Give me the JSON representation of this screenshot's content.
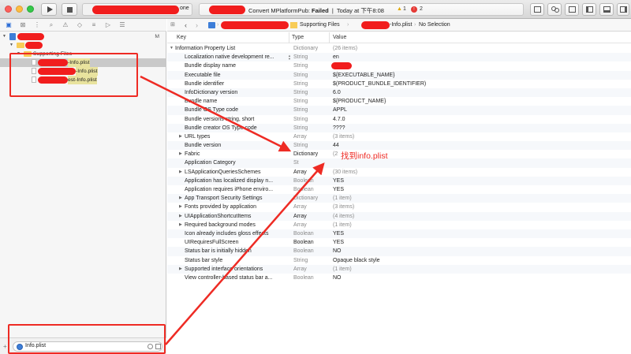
{
  "toolbar": {
    "scheme_tail": "one",
    "activity_prefix": "Convert MPlatformPub:",
    "activity_status": "Failed",
    "activity_time": "Today at 下午8:08",
    "warnings_count": "1",
    "errors_count": "2"
  },
  "navigator": {
    "project_badge": "M",
    "items": [
      {
        "label": "Supporting Files"
      },
      {
        "label": "-Info.plist",
        "selected": true
      },
      {
        "label": "-Info.plist"
      },
      {
        "label": "est-Info.plist"
      }
    ],
    "filter_value": "Info.plist"
  },
  "jumpbar": {
    "supporting_files": "Supporting Files",
    "file_name": "-Info.plist",
    "selection": "No Selection"
  },
  "plist": {
    "headers": {
      "key": "Key",
      "type": "Type",
      "value": "Value"
    },
    "rows": [
      {
        "key": "Information Property List",
        "type": "Dictionary",
        "value": "(26 items)",
        "root": true,
        "expand": "open",
        "dim": true
      },
      {
        "key": "Localization native development re...",
        "type": "String",
        "value": "en",
        "stepper": true
      },
      {
        "key": "Bundle display name",
        "type": "String",
        "value": ""
      },
      {
        "key": "Executable file",
        "type": "String",
        "value": "${EXECUTABLE_NAME}"
      },
      {
        "key": "Bundle identifier",
        "type": "String",
        "value": "$(PRODUCT_BUNDLE_IDENTIFIER)"
      },
      {
        "key": "InfoDictionary version",
        "type": "String",
        "value": "6.0"
      },
      {
        "key": "Bundle name",
        "type": "String",
        "value": "${PRODUCT_NAME}"
      },
      {
        "key": "Bundle OS Type code",
        "type": "String",
        "value": "APPL"
      },
      {
        "key": "Bundle versions string, short",
        "type": "String",
        "value": "4.7.0"
      },
      {
        "key": "Bundle creator OS Type code",
        "type": "String",
        "value": "????"
      },
      {
        "key": "URL types",
        "type": "Array",
        "value": "(3 items)",
        "expand": "closed",
        "dim": true
      },
      {
        "key": "Bundle version",
        "type": "String",
        "value": "44"
      },
      {
        "key": "Fabric",
        "type": "Dictionary",
        "value": "(2",
        "expand": "closed",
        "dim": true,
        "strongType": true
      },
      {
        "key": "Application Category",
        "type": "St",
        "value": ""
      },
      {
        "key": "LSApplicationQueriesSchemes",
        "type": "Array",
        "value": "(30 items)",
        "expand": "closed",
        "dim": true,
        "strongType": true
      },
      {
        "key": "Application has localized display n...",
        "type": "Boolean",
        "value": "YES"
      },
      {
        "key": "Application requires iPhone enviro...",
        "type": "Boolean",
        "value": "YES"
      },
      {
        "key": "App Transport Security Settings",
        "type": "Dictionary",
        "value": "(1 item)",
        "expand": "closed",
        "dim": true
      },
      {
        "key": "Fonts provided by application",
        "type": "Array",
        "value": "(3 items)",
        "expand": "closed",
        "dim": true
      },
      {
        "key": "UIApplicationShortcutItems",
        "type": "Array",
        "value": "(4 items)",
        "expand": "closed",
        "dim": true,
        "strongType": true
      },
      {
        "key": "Required background modes",
        "type": "Array",
        "value": "(1 item)",
        "expand": "closed",
        "dim": true
      },
      {
        "key": "Icon already includes gloss effects",
        "type": "Boolean",
        "value": "YES"
      },
      {
        "key": "UIRequiresFullScreen",
        "type": "Boolean",
        "value": "YES",
        "strongType": true
      },
      {
        "key": "Status bar is initially hidden",
        "type": "Boolean",
        "value": "NO"
      },
      {
        "key": "Status bar style",
        "type": "String",
        "value": "Opaque black style"
      },
      {
        "key": "Supported interface orientations",
        "type": "Array",
        "value": "(1 item)",
        "expand": "closed",
        "dim": true
      },
      {
        "key": "View controller-based status bar a...",
        "type": "Boolean",
        "value": "NO"
      }
    ]
  },
  "annotation": {
    "text": "找到info.plist",
    "color": "#ee2b24"
  },
  "colors": {
    "accent": "#3d7ed8",
    "redaction": "#f11d1d",
    "selection": "#c9c9c9"
  }
}
